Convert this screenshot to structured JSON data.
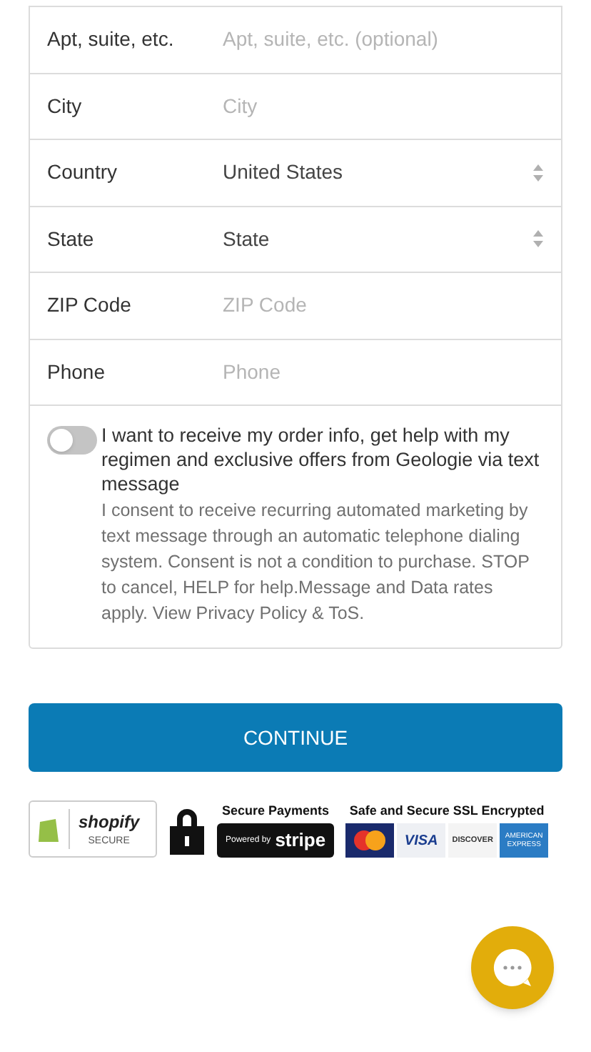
{
  "fields": [
    {
      "kind": "text",
      "label": "Apt, suite, etc.",
      "placeholder": "Apt, suite, etc. (optional)"
    },
    {
      "kind": "text",
      "label": "City",
      "placeholder": "City"
    },
    {
      "kind": "select",
      "label": "Country",
      "value": "United States"
    },
    {
      "kind": "select",
      "label": "State",
      "value": "State"
    },
    {
      "kind": "text",
      "label": "ZIP Code",
      "placeholder": "ZIP Code"
    },
    {
      "kind": "text",
      "label": "Phone",
      "placeholder": "Phone"
    }
  ],
  "sms_opt_in": {
    "on": false,
    "label": "I want to receive my order info, get help with my regimen and exclusive offers from Geologie via text message",
    "disclaimer": "I consent to receive recurring automated marketing by text message through an automatic telephone dialing system. Consent is not a condition to purchase. STOP to cancel, HELP for help.Message and Data rates apply. View Privacy Policy & ToS."
  },
  "continue_button": "CONTINUE",
  "badges": {
    "shopify": {
      "name": "shopify",
      "caption": "SECURE"
    },
    "stripe": {
      "heading": "Secure Payments",
      "powered": "Powered by",
      "name": "stripe"
    },
    "cards": {
      "heading": "Safe and Secure SSL Encrypted",
      "visa": "VISA",
      "discover": "DISCOVER",
      "amex": "AMERICAN EXPRESS"
    }
  }
}
